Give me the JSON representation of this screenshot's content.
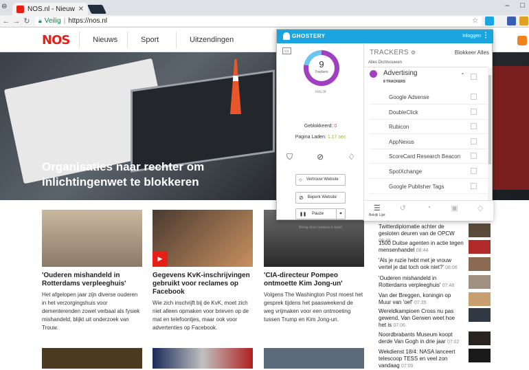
{
  "browser": {
    "tab_title": "NOS.nl - Nieuws, Sport e",
    "tab_close": "✕",
    "secure_label": "Veilig",
    "url": "https://nos.nl"
  },
  "site": {
    "logo": "NOS",
    "nav": [
      "Nieuws",
      "Sport",
      "Uitzendingen"
    ],
    "hero_title": "Organisaties naar rechter om inlichtingenwet te blokkeren",
    "cards": [
      {
        "title": "'Ouderen mishandeld in Rotterdams verpleeghuis'",
        "text": "Het afgelopen jaar zijn diverse ouderen in het verzorgingshuis voor dementerenden zowel verbaal als fysiek mishandeld, blijkt uit onderzoek van Trouw."
      },
      {
        "title": "Gegevens KvK-inschrijvingen gebruikt voor reclames op Facebook",
        "text": "Wie zich inschrijft bij de KvK, moet zich niet alleen opmaken voor brieven op de mat en telefoontjes, maar ook voor advertenties op Facebook."
      },
      {
        "title": "'CIA-directeur Pompeo ontmoette Kim Jong-un'",
        "text": "Volgens The Washington Post moest het gesprek tijdens het paasweekend de weg vrijmaken voor een ontmoeting tussen Trump en Kim Jong-un."
      }
    ],
    "latest": [
      {
        "text": "Twitterdiplomatie achter de gesloten deuren van de OPCW",
        "time": "08:49"
      },
      {
        "text": "1500 Duitse agenten in actie tegen mensenhandel",
        "time": "08:44"
      },
      {
        "text": "'Als je ruzie hebt met je vrouw vertel je dat toch ook niet?'",
        "time": "08:06"
      },
      {
        "text": "'Ouderen mishandeld in Rotterdams verpleeghuis'",
        "time": "07:48"
      },
      {
        "text": "Van der Breggen, koningin op Muur van 'oef'",
        "time": "07:35"
      },
      {
        "text": "Wereldkampioen Cross nu pas gewend, Van Gerwen weet hoe het is",
        "time": "07:06"
      },
      {
        "text": "Noordbrabants Museum koopt derde Van Gogh in drie jaar",
        "time": "07:02"
      },
      {
        "text": "Wekdienst 18/4: NASA lanceert telescoop TESS en veel zon vandaag",
        "time": "07:00"
      }
    ]
  },
  "ghostery": {
    "brand": "GHOSTERY",
    "login": "Inloggen",
    "tracker_count": "9",
    "tracker_label": "Trackers",
    "site": "nos.nl",
    "blocked_label": "Geblokkeerd:",
    "blocked_value": "0",
    "load_label": "Pagina Laden:",
    "load_value": "1.17 sec",
    "trust_button": "Vertrouw Website",
    "restrict_button": "Beperk Website",
    "pause_button": "Pauze",
    "bring_text": "Breng deze trackers in kaart",
    "trackers_heading": "TRACKERS",
    "block_all": "Blokkeer Alles",
    "collapse_all": "Alles Dichtvouwen",
    "category": {
      "name": "Advertising",
      "count": "8 TRACKERS"
    },
    "trackers": [
      "Google Adsense",
      "DoubleClick",
      "Rubicon",
      "AppNexus",
      "ScoreCard Research Beacon",
      "SpotXchange",
      "Google Publisher Tags"
    ],
    "bottom_tab_label": "Bekijk Lijst"
  }
}
